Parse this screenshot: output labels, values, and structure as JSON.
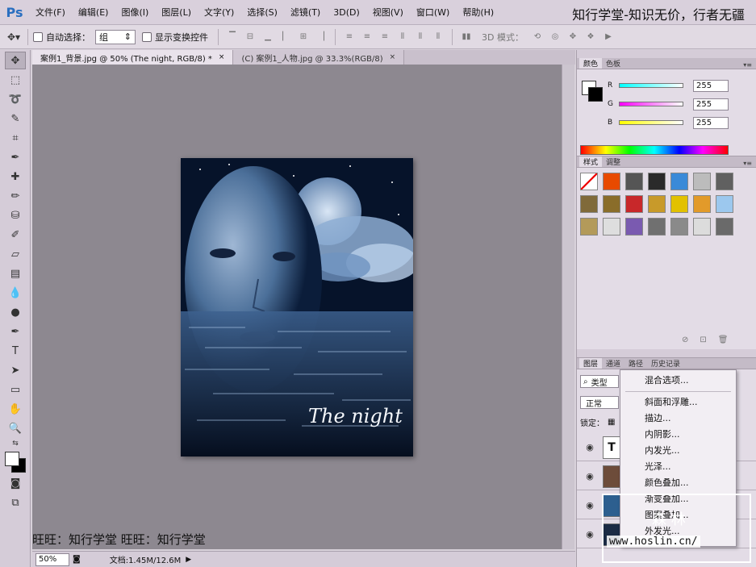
{
  "app": {
    "logo": "Ps"
  },
  "menubar": {
    "items": [
      "文件(F)",
      "编辑(E)",
      "图像(I)",
      "图层(L)",
      "文字(Y)",
      "选择(S)",
      "滤镜(T)",
      "3D(D)",
      "视图(V)",
      "窗口(W)",
      "帮助(H)"
    ]
  },
  "overlay": {
    "top_slogan": "知行学堂-知识无价，行者无疆",
    "bottom_text": "旺旺：知行学堂 旺旺：知行学堂"
  },
  "options": {
    "auto_select_label": "自动选择：",
    "auto_select_value": "组",
    "show_transform_label": "显示变换控件",
    "mode_3d_label": "3D 模式："
  },
  "documents": {
    "tabs": [
      {
        "label": "案例1_背景.jpg @ 50% (The night, RGB/8) *",
        "close": "×"
      },
      {
        "label": "(C) 案例1_人物.jpg @ 33.3%(RGB/8)",
        "close": "×"
      }
    ]
  },
  "canvas": {
    "text": "The night"
  },
  "status": {
    "zoom": "50%",
    "doc_size": "文档:1.45M/12.6M"
  },
  "color_panel": {
    "tabs": [
      "颜色",
      "色板"
    ],
    "channels": [
      {
        "label": "R",
        "value": "255"
      },
      {
        "label": "G",
        "value": "255"
      },
      {
        "label": "B",
        "value": "255"
      }
    ]
  },
  "styles_panel": {
    "tabs": [
      "样式",
      "调整"
    ],
    "swatches": [
      "#ffffff",
      "#e84a00",
      "#555",
      "#2a2a2a",
      "#3a8ad8",
      "#bcbcbc",
      "#606060",
      "#806a3a",
      "#8a6d2a",
      "#c8282a",
      "#c89a2a",
      "#e2c100",
      "#e29a2a",
      "#9cc8ee",
      "#b39a5a",
      "#dedede",
      "#7a5ab0",
      "#707070",
      "#8a8a8a",
      "#dcdcdc",
      "#6a6a6a"
    ]
  },
  "layers_panel": {
    "tabs": [
      "图层",
      "通道",
      "路径",
      "历史记录"
    ],
    "filter_label": "类型",
    "blend_mode": "正常",
    "lock_label": "锁定：",
    "layers": [
      {
        "kind": "text",
        "thumb": "T"
      },
      {
        "kind": "image",
        "thumb": ""
      },
      {
        "kind": "image",
        "thumb": ""
      },
      {
        "kind": "image",
        "thumb": ""
      }
    ]
  },
  "context_menu": {
    "items": [
      "混合选项...",
      "斜面和浮雕...",
      "描边...",
      "内阴影...",
      "内发光...",
      "光泽...",
      "颜色叠加...",
      "渐变叠加...",
      "图案叠加...",
      "外发光..."
    ]
  },
  "site_watermark": {
    "brand": "森 林",
    "url": "www.hoslin.cn/"
  }
}
